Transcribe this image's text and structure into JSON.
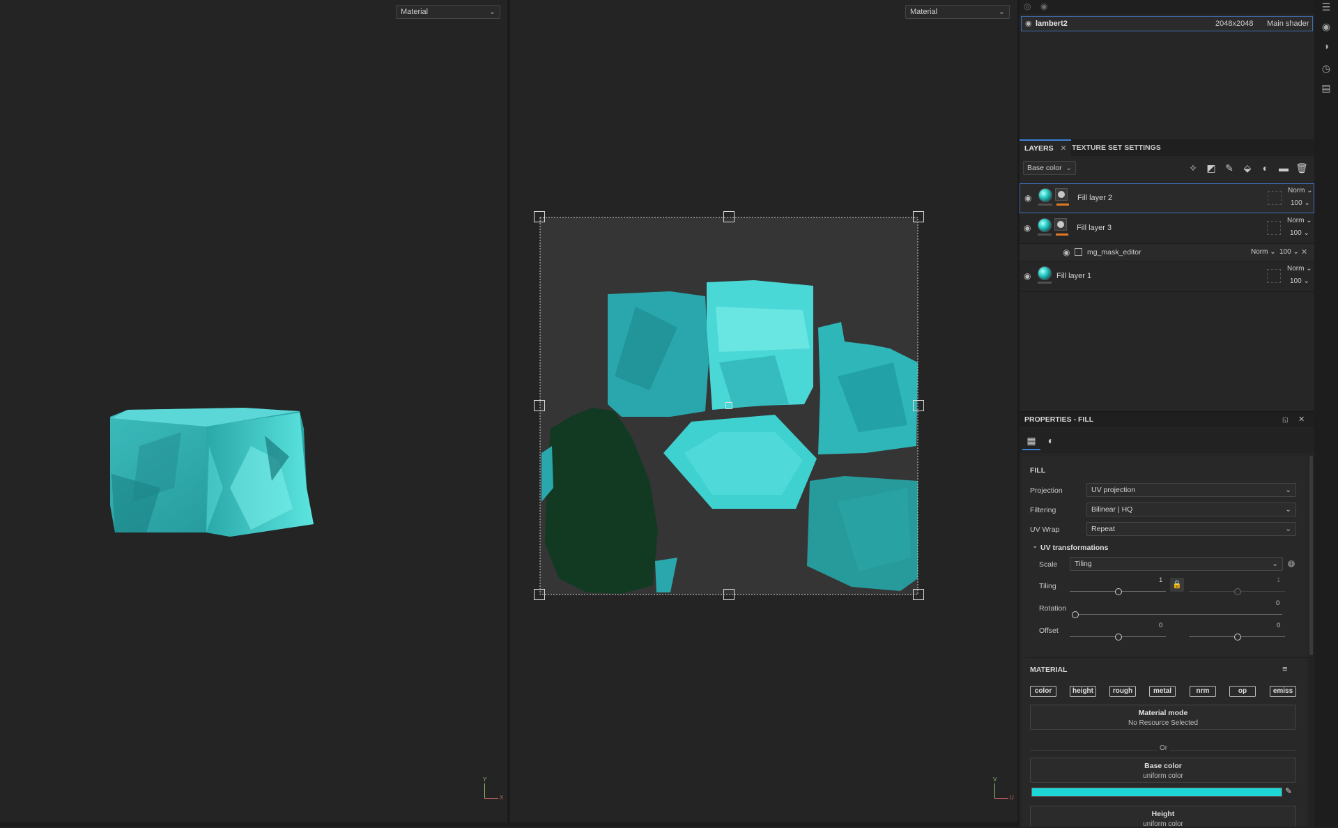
{
  "viewport3d": {
    "mode_select": "Material",
    "axes": {
      "y": "Y",
      "x": "X"
    }
  },
  "viewport_uv": {
    "mode_select": "Material",
    "axes": {
      "v": "V",
      "u": "U"
    }
  },
  "texture_set": {
    "name": "lambert2",
    "resolution": "2048x2048",
    "shader": "Main shader"
  },
  "tabs": {
    "layers": "LAYERS",
    "texture_set_settings": "TEXTURE SET SETTINGS"
  },
  "layers_toolbar": {
    "channel": "Base color"
  },
  "layers": [
    {
      "name": "Fill layer 2",
      "blend": "Norm",
      "opacity": "100"
    },
    {
      "name": "Fill layer 3",
      "blend": "Norm",
      "opacity": "100"
    },
    {
      "name": "Fill layer 1",
      "blend": "Norm",
      "opacity": "100"
    }
  ],
  "sub_layer": {
    "name": "mg_mask_editor",
    "blend": "Norm",
    "opacity": "100"
  },
  "properties": {
    "title": "PROPERTIES - FILL",
    "fill": {
      "section": "FILL",
      "projection_label": "Projection",
      "projection_value": "UV projection",
      "filtering_label": "Filtering",
      "filtering_value": "Bilinear | HQ",
      "uvwrap_label": "UV Wrap",
      "uvwrap_value": "Repeat",
      "uvtrans_label": "UV transformations",
      "scale_label": "Scale",
      "scale_value": "Tiling",
      "tiling_label": "Tiling",
      "tiling_u": "1",
      "tiling_v": "1",
      "rotation_label": "Rotation",
      "rotation_value": "0",
      "offset_label": "Offset",
      "offset_u": "0",
      "offset_v": "0"
    },
    "material": {
      "section": "MATERIAL",
      "chips": [
        "color",
        "height",
        "rough",
        "metal",
        "nrm",
        "op",
        "emiss"
      ],
      "mode_title": "Material mode",
      "mode_sub": "No Resource Selected",
      "or": "Or",
      "base_title": "Base color",
      "base_sub": "uniform color",
      "base_color": "#1fd6d6",
      "height_title": "Height",
      "height_sub": "uniform color"
    }
  },
  "sliders": {
    "tiling_u": 0.5,
    "tiling_v": 0.5,
    "rotation": 0.0,
    "offset_u": 0.5,
    "offset_v": 0.5
  },
  "colors": {
    "accent": "#3b82d6",
    "mask_bar": "#e07a24",
    "uv_island": "#3fd6d6",
    "uv_dark": "#123a22"
  }
}
